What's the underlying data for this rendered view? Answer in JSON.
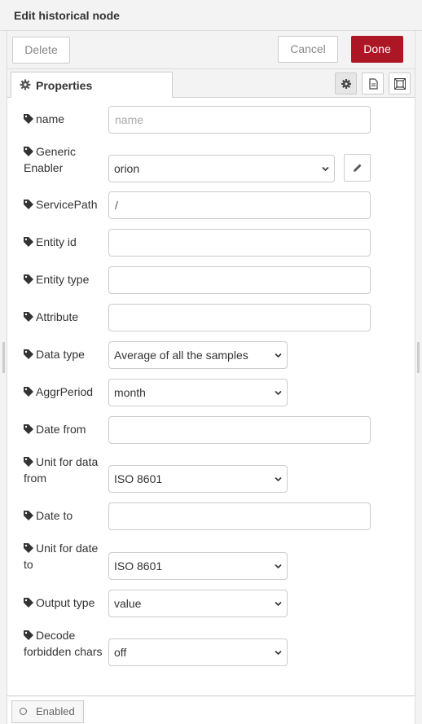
{
  "header": {
    "title": "Edit historical node"
  },
  "toolbar": {
    "delete_label": "Delete",
    "cancel_label": "Cancel",
    "done_label": "Done",
    "done_color": "#ad1625"
  },
  "tabs": {
    "properties_label": "Properties",
    "icons": [
      "gear-icon",
      "description-icon",
      "appearance-icon"
    ]
  },
  "form": {
    "name": {
      "label": "name",
      "placeholder": "name",
      "value": ""
    },
    "generic_enabler": {
      "label_line1": "Generic",
      "label_line2": "Enabler",
      "value": "orion"
    },
    "service_path": {
      "label": "ServicePath",
      "value": "/"
    },
    "entity_id": {
      "label": "Entity id",
      "value": ""
    },
    "entity_type": {
      "label": "Entity type",
      "value": ""
    },
    "attribute": {
      "label": "Attribute",
      "value": ""
    },
    "data_type": {
      "label": "Data type",
      "value": "Average of all the samples"
    },
    "aggr_period": {
      "label": "AggrPeriod",
      "value": "month"
    },
    "date_from": {
      "label": "Date from",
      "value": ""
    },
    "unit_from": {
      "label_line1": "Unit for data",
      "label_line2": "from",
      "value": "ISO 8601"
    },
    "date_to": {
      "label": "Date to",
      "value": ""
    },
    "unit_to": {
      "label_line1": "Unit for date",
      "label_line2": "to",
      "value": "ISO 8601"
    },
    "output_type": {
      "label": "Output type",
      "value": "value"
    },
    "decode": {
      "label_line1": "Decode",
      "label_line2": "forbidden chars",
      "value": "off"
    }
  },
  "footer": {
    "enabled_label": "Enabled"
  }
}
